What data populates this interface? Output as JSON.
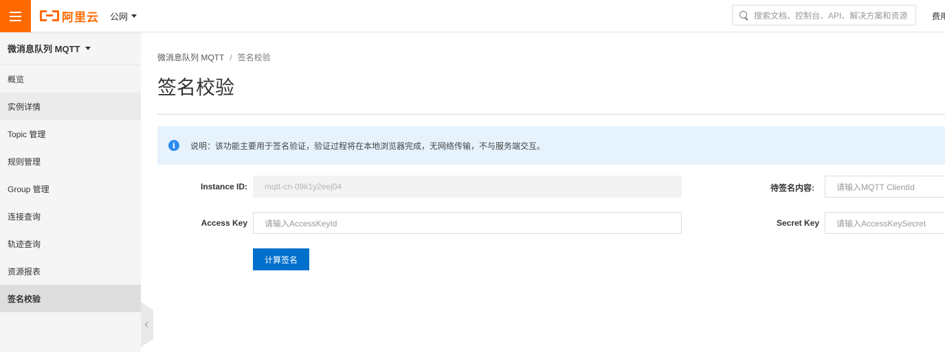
{
  "topbar": {
    "logo_text": "阿里云",
    "region": "公网",
    "search_placeholder": "搜索文档、控制台、API、解决方案和资源",
    "right_link": "费用"
  },
  "sidebar": {
    "product": "微消息队列 MQTT",
    "items": [
      {
        "label": "概览"
      },
      {
        "label": "实例详情"
      },
      {
        "label": "Topic 管理"
      },
      {
        "label": "规则管理"
      },
      {
        "label": "Group 管理"
      },
      {
        "label": "连接查询"
      },
      {
        "label": "轨迹查询"
      },
      {
        "label": "资源报表"
      },
      {
        "label": "签名校验"
      }
    ]
  },
  "breadcrumb": {
    "parent": "微消息队列 MQTT",
    "separator": "/",
    "current": "签名校验"
  },
  "page_title": "签名校验",
  "notice": {
    "icon": "i",
    "text": "说明：该功能主要用于签名验证，验证过程将在本地浏览器完成，无网络传输，不与服务端交互。"
  },
  "form": {
    "instance_id_label": "Instance ID:",
    "instance_id_value": "mqtt-cn-09k1y2eej04",
    "access_key_label": "Access Key",
    "access_key_placeholder": "请输入AccessKeyId",
    "sign_content_label": "待签名内容:",
    "sign_content_placeholder": "请输入MQTT ClientId",
    "secret_key_label": "Secret Key",
    "secret_key_placeholder": "请输入AccessKeySecret",
    "submit_label": "计算签名"
  },
  "colors": {
    "brand": "#ff6a00",
    "primary": "#0070cc",
    "notice_bg": "#e6f3fd",
    "info_icon": "#2d8cf0"
  }
}
